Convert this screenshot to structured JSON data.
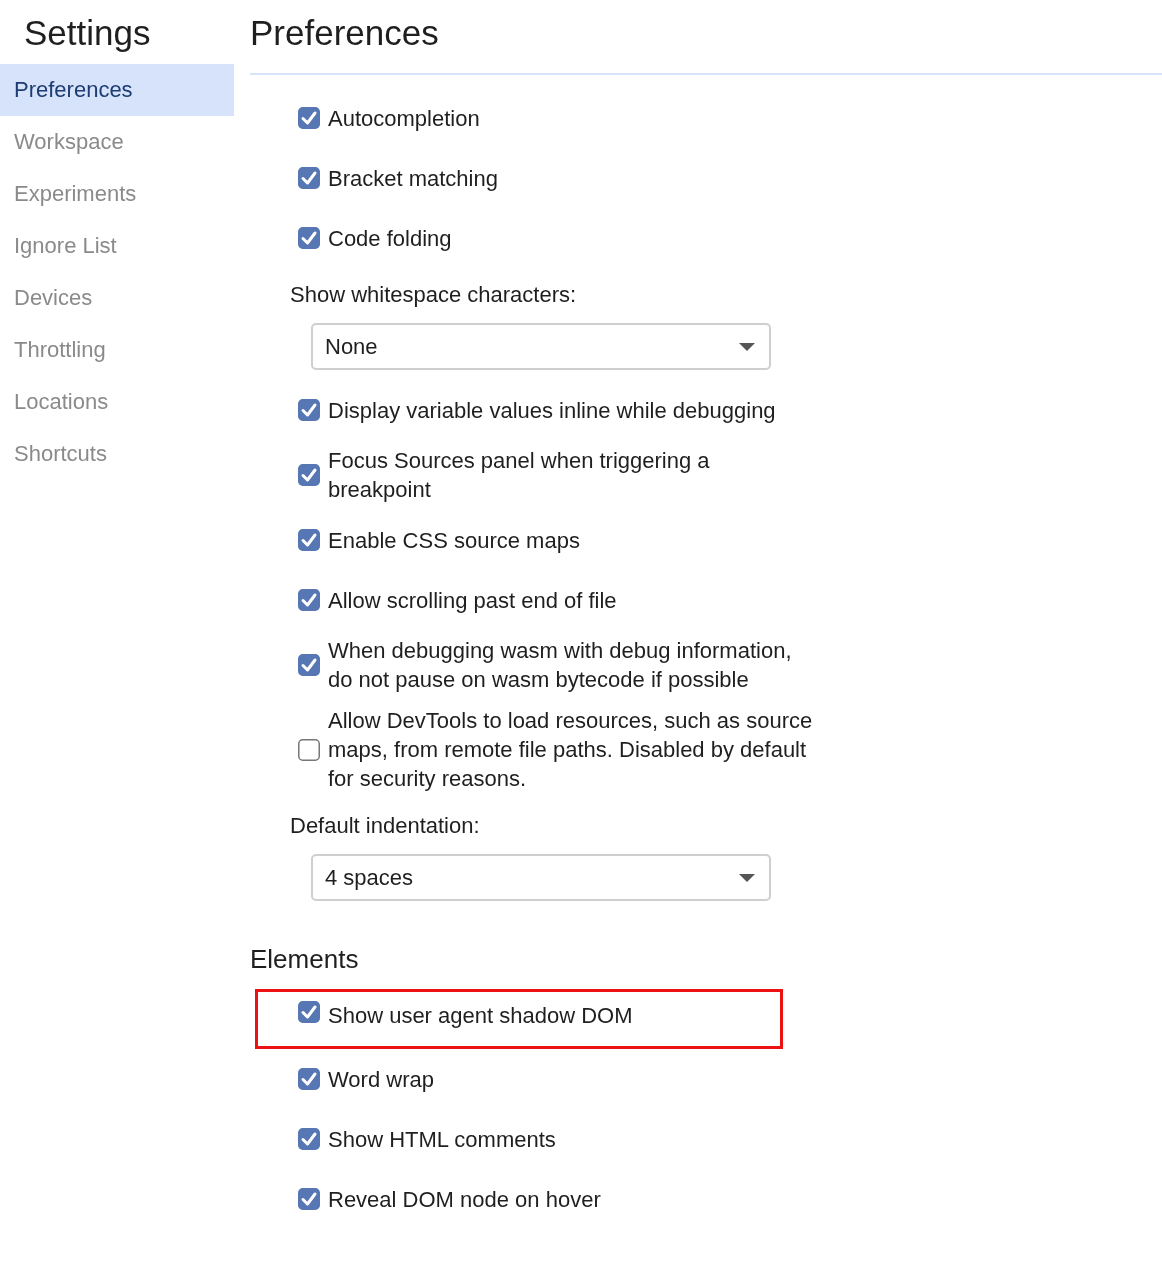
{
  "sidebar": {
    "title": "Settings",
    "items": [
      {
        "label": "Preferences",
        "selected": true
      },
      {
        "label": "Workspace",
        "selected": false
      },
      {
        "label": "Experiments",
        "selected": false
      },
      {
        "label": "Ignore List",
        "selected": false
      },
      {
        "label": "Devices",
        "selected": false
      },
      {
        "label": "Throttling",
        "selected": false
      },
      {
        "label": "Locations",
        "selected": false
      },
      {
        "label": "Shortcuts",
        "selected": false
      }
    ]
  },
  "page": {
    "title": "Preferences"
  },
  "sections": [
    {
      "items": [
        {
          "kind": "checkbox",
          "label": "Autocompletion",
          "checked": true
        },
        {
          "kind": "checkbox",
          "label": "Bracket matching",
          "checked": true
        },
        {
          "kind": "checkbox",
          "label": "Code folding",
          "checked": true
        },
        {
          "kind": "label",
          "label": "Show whitespace characters:"
        },
        {
          "kind": "select",
          "value": "None"
        },
        {
          "kind": "checkbox",
          "label": "Display variable values inline while debugging",
          "checked": true
        },
        {
          "kind": "checkbox",
          "label": "Focus Sources panel when triggering a\nbreakpoint",
          "checked": true
        },
        {
          "kind": "checkbox",
          "label": "Enable CSS source maps",
          "checked": true
        },
        {
          "kind": "checkbox",
          "label": "Allow scrolling past end of file",
          "checked": true
        },
        {
          "kind": "checkbox",
          "label": "When debugging wasm with debug information,\ndo not pause on wasm bytecode if possible",
          "checked": true
        },
        {
          "kind": "checkbox",
          "label": "Allow DevTools to load resources, such as source\nmaps, from remote file paths. Disabled by default\nfor security reasons.",
          "checked": false
        },
        {
          "kind": "label",
          "label": "Default indentation:"
        },
        {
          "kind": "select",
          "value": "4 spaces"
        }
      ]
    },
    {
      "title": "Elements",
      "items": [
        {
          "kind": "checkbox",
          "label": "Show user agent shadow DOM",
          "checked": true,
          "highlighted": true
        },
        {
          "kind": "checkbox",
          "label": "Word wrap",
          "checked": true
        },
        {
          "kind": "checkbox",
          "label": "Show HTML comments",
          "checked": true
        },
        {
          "kind": "checkbox",
          "label": "Reveal DOM node on hover",
          "checked": true
        }
      ]
    }
  ]
}
